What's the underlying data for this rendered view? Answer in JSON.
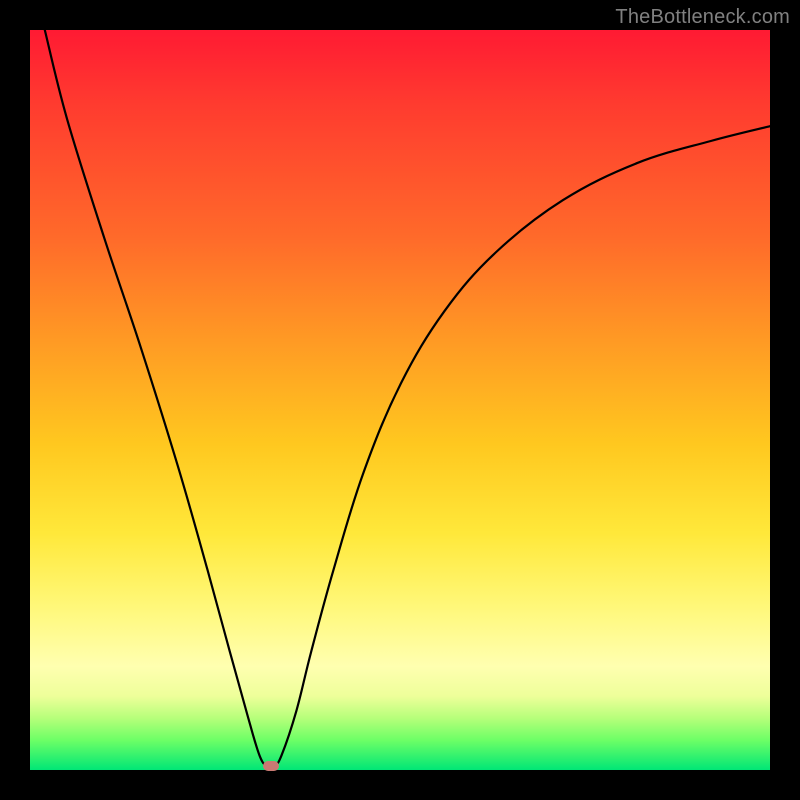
{
  "watermark": "TheBottleneck.com",
  "chart_data": {
    "type": "line",
    "title": "",
    "xlabel": "",
    "ylabel": "",
    "xlim": [
      0,
      100
    ],
    "ylim": [
      0,
      100
    ],
    "grid": false,
    "legend": false,
    "background_gradient_stops": [
      {
        "pos": 0,
        "color": "#ff1a33"
      },
      {
        "pos": 28,
        "color": "#ff6a2a"
      },
      {
        "pos": 56,
        "color": "#ffc81f"
      },
      {
        "pos": 78,
        "color": "#fff87a"
      },
      {
        "pos": 93,
        "color": "#b6ff7a"
      },
      {
        "pos": 100,
        "color": "#00e676"
      }
    ],
    "series": [
      {
        "name": "bottleneck-curve",
        "color": "#000000",
        "x": [
          2,
          5,
          10,
          15,
          20,
          24,
          27,
          29.5,
          31,
          32,
          33,
          34,
          36,
          38,
          41,
          45,
          50,
          56,
          63,
          72,
          82,
          92,
          100
        ],
        "y": [
          100,
          88,
          72,
          57,
          41,
          27,
          16,
          7,
          2,
          0.5,
          0.5,
          2,
          8,
          16,
          27,
          40,
          52,
          62,
          70,
          77,
          82,
          85,
          87
        ]
      }
    ],
    "minimum_marker": {
      "x": 32.5,
      "y": 0.5,
      "shape": "rounded-rect",
      "color": "#c97a73"
    }
  }
}
